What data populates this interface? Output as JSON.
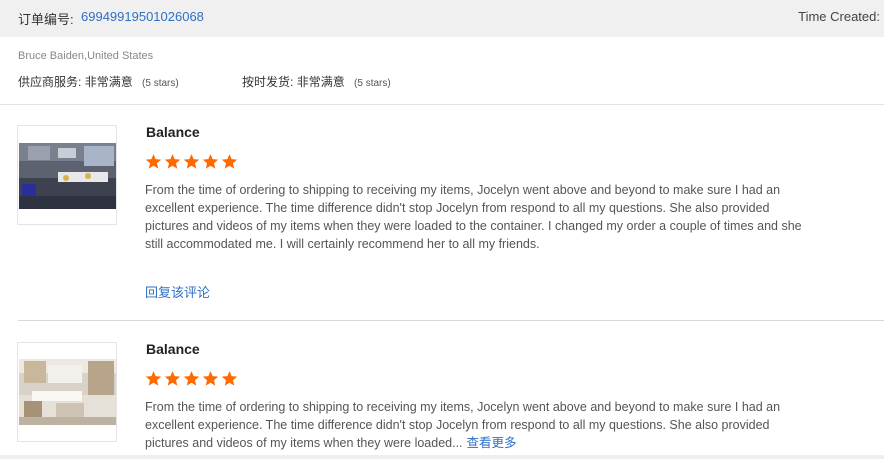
{
  "order": {
    "label": "订单编号:",
    "number": "69949919501026068",
    "time_created_label": "Time Created:"
  },
  "buyer": {
    "name": "Bruce Baiden,United States",
    "ratings": [
      {
        "label": "供应商服务:",
        "value": "非常满意",
        "stars_text": "(5 stars)"
      },
      {
        "label": "按时发货:",
        "value": "非常满意",
        "stars_text": "(5 stars)"
      }
    ]
  },
  "colors": {
    "star": "#ff6a00",
    "link": "#2f6fc5"
  },
  "reviews": [
    {
      "product": "Balance",
      "rating": 5,
      "image": "kitchen-photo-dark",
      "text": "From the time of ordering to shipping to receiving my items, Jocelyn went above and beyond to make sure I had an excellent experience. The time difference didn't stop Jocelyn from respond to all my questions. She also provided pictures and videos of my items when they were loaded to the container. I changed my order a couple of times and she still accommodated me. I will certainly recommend her to all my friends.",
      "reply_label": "回复该评论"
    },
    {
      "product": "Balance",
      "rating": 5,
      "image": "kitchen-photo-light",
      "text": "From the time of ordering to shipping to receiving my items, Jocelyn went above and beyond to make sure I had an excellent experience. The time difference didn't stop Jocelyn from respond to all my questions. She also provided pictures and videos of my items when they were loaded...",
      "see_more_label": "查看更多"
    }
  ]
}
